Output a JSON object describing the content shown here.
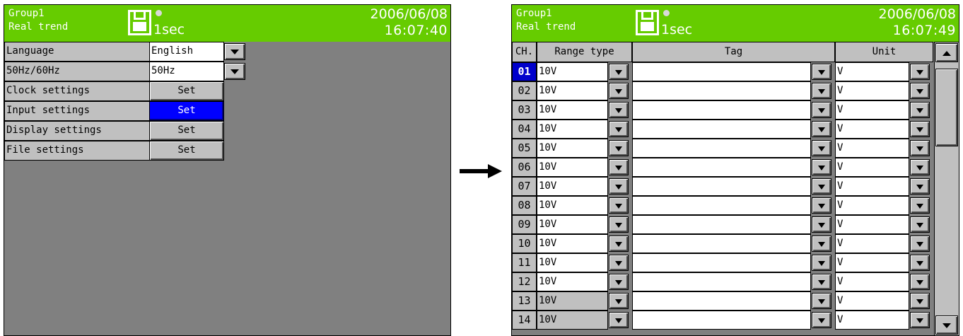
{
  "colors": {
    "header_green": "#66cc00",
    "panel_gray": "#808080",
    "control_gray": "#c0c0c0",
    "selection_blue": "#0000ff"
  },
  "left": {
    "header": {
      "group": "Group1",
      "mode": "Real trend",
      "rate": "1sec",
      "date": "2006/06/08",
      "time": "16:07:40",
      "icons": [
        "floppy-disk-icon",
        "status-led-icon"
      ]
    },
    "menu": {
      "language": {
        "label": "Language",
        "value": "English"
      },
      "freq": {
        "label": "50Hz/60Hz",
        "value": "50Hz"
      },
      "clock": {
        "label": "Clock settings",
        "button": "Set"
      },
      "input": {
        "label": "Input settings",
        "button": "Set"
      },
      "display": {
        "label": "Display settings",
        "button": "Set"
      },
      "file": {
        "label": "File settings",
        "button": "Set"
      }
    }
  },
  "right": {
    "header": {
      "group": "Group1",
      "mode": "Real trend",
      "rate": "1sec",
      "date": "2006/06/08",
      "time": "16:07:49"
    },
    "columns": {
      "ch": "CH.",
      "range": "Range type",
      "tag": "Tag",
      "unit": "Unit"
    },
    "rows": [
      {
        "ch": "01",
        "range": "10V",
        "tag": "",
        "unit": "V",
        "selected": true
      },
      {
        "ch": "02",
        "range": "10V",
        "tag": "",
        "unit": "V"
      },
      {
        "ch": "03",
        "range": "10V",
        "tag": "",
        "unit": "V"
      },
      {
        "ch": "04",
        "range": "10V",
        "tag": "",
        "unit": "V"
      },
      {
        "ch": "05",
        "range": "10V",
        "tag": "",
        "unit": "V"
      },
      {
        "ch": "06",
        "range": "10V",
        "tag": "",
        "unit": "V"
      },
      {
        "ch": "07",
        "range": "10V",
        "tag": "",
        "unit": "V"
      },
      {
        "ch": "08",
        "range": "10V",
        "tag": "",
        "unit": "V"
      },
      {
        "ch": "09",
        "range": "10V",
        "tag": "",
        "unit": "V"
      },
      {
        "ch": "10",
        "range": "10V",
        "tag": "",
        "unit": "V"
      },
      {
        "ch": "11",
        "range": "10V",
        "tag": "",
        "unit": "V"
      },
      {
        "ch": "12",
        "range": "10V",
        "tag": "",
        "unit": "V"
      },
      {
        "ch": "13",
        "range": "10V",
        "tag": "",
        "unit": "V",
        "range_disabled": true
      },
      {
        "ch": "14",
        "range": "10V",
        "tag": "",
        "unit": "V",
        "range_disabled": true
      }
    ]
  }
}
